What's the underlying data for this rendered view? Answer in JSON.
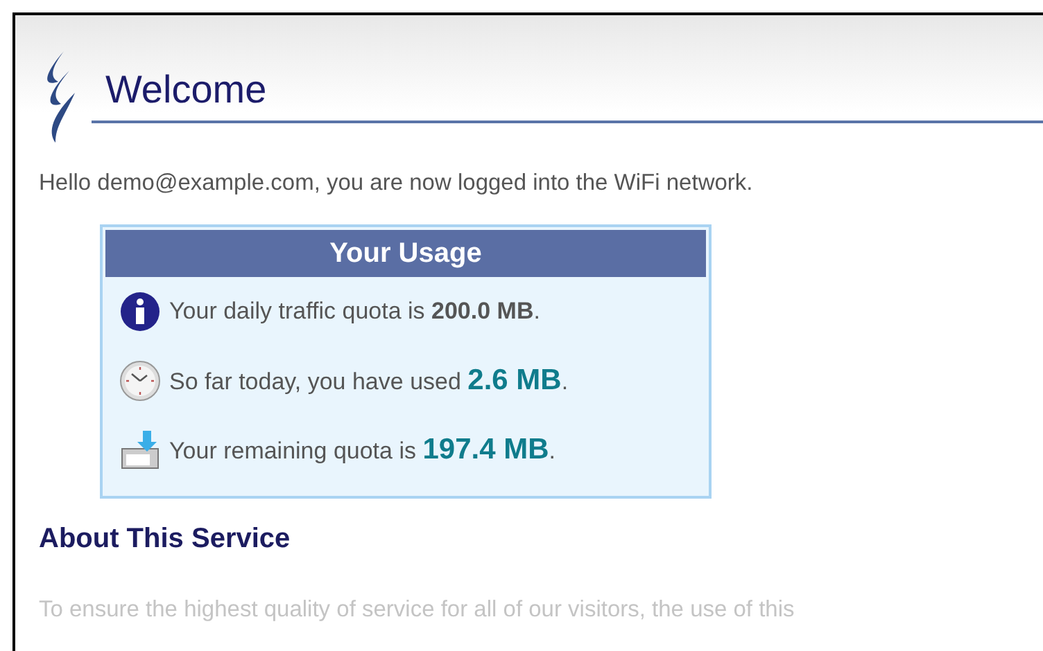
{
  "header": {
    "title": "Welcome"
  },
  "greeting": "Hello demo@example.com, you are now logged into the WiFi network.",
  "usage": {
    "title": "Your Usage",
    "rows": [
      {
        "kind": "info",
        "before": "Your daily traffic quota is ",
        "value": "200.0 MB",
        "after": ".",
        "highlight": false
      },
      {
        "kind": "clock",
        "before": "So far today, you have used ",
        "value": "2.6 MB",
        "after": ".",
        "highlight": true
      },
      {
        "kind": "download",
        "before": "Your remaining quota is ",
        "value": "197.4 MB",
        "after": ".",
        "highlight": true
      }
    ]
  },
  "about": {
    "title": "About This Service",
    "text": "To ensure the highest quality of service for all of our visitors, the use of this"
  }
}
